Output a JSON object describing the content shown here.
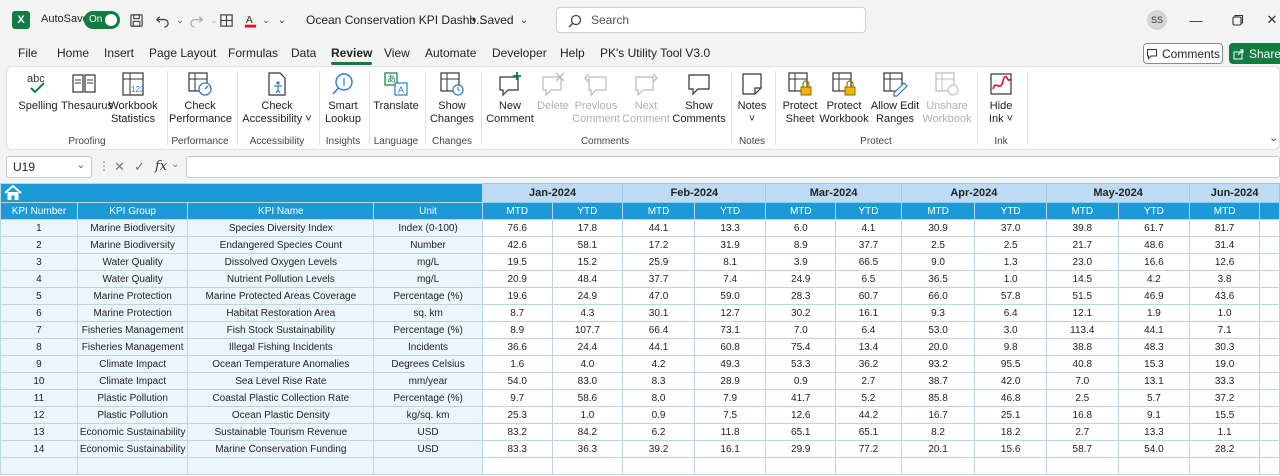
{
  "titlebar": {
    "logo": "X",
    "autosave_label": "AutoSave",
    "toggle_text": "On",
    "doc_title": "Ocean Conservation KPI Dashb...",
    "saved": "• Saved",
    "search_placeholder": "Search",
    "avatar": "SS"
  },
  "menu": [
    "File",
    "Home",
    "Insert",
    "Page Layout",
    "Formulas",
    "Data",
    "Review",
    "View",
    "Automate",
    "Developer",
    "Help",
    "PK's Utility Tool V3.0"
  ],
  "menu_active": "Review",
  "comments_label": "Comments",
  "share_label": "Share",
  "ribbon": {
    "spelling": "Spelling",
    "thesaurus": "Thesaurus",
    "workbook_statistics_1": "Workbook",
    "workbook_statistics_2": "Statistics",
    "check_performance_1": "Check",
    "check_performance_2": "Performance",
    "check_accessibility_1": "Check",
    "check_accessibility_2": "Accessibility ˅",
    "smart_lookup_1": "Smart",
    "smart_lookup_2": "Lookup",
    "translate": "Translate",
    "show_changes_1": "Show",
    "show_changes_2": "Changes",
    "new_comment_1": "New",
    "new_comment_2": "Comment",
    "delete": "Delete",
    "previous_comment_1": "Previous",
    "previous_comment_2": "Comment",
    "next_comment_1": "Next",
    "next_comment_2": "Comment",
    "show_comments_1": "Show",
    "show_comments_2": "Comments",
    "notes_1": "Notes",
    "notes_2": "˅",
    "protect_sheet_1": "Protect",
    "protect_sheet_2": "Sheet",
    "protect_workbook_1": "Protect",
    "protect_workbook_2": "Workbook",
    "allow_edit_ranges_1": "Allow Edit",
    "allow_edit_ranges_2": "Ranges",
    "unshare_workbook_1": "Unshare",
    "unshare_workbook_2": "Workbook",
    "hide_ink_1": "Hide",
    "hide_ink_2": "Ink ˅",
    "groups": {
      "proofing": "Proofing",
      "performance": "Performance",
      "accessibility": "Accessibility",
      "insights": "Insights",
      "language": "Language",
      "changes": "Changes",
      "comments": "Comments",
      "notes": "Notes",
      "protect": "Protect",
      "ink": "Ink"
    }
  },
  "formula_bar": {
    "name_box": "U19",
    "fx": "fx"
  },
  "grid": {
    "months": [
      "Jan-2024",
      "Feb-2024",
      "Mar-2024",
      "Apr-2024",
      "May-2024",
      "Jun-2024"
    ],
    "headers": [
      "KPI Number",
      "KPI Group",
      "KPI Name",
      "Unit"
    ],
    "mtd": "MTD",
    "ytd": "YTD",
    "rows": [
      {
        "n": "1",
        "group": "Marine Biodiversity",
        "name": "Species Diversity Index",
        "unit": "Index (0-100)",
        "vals": [
          "76.6",
          "17.8",
          "44.1",
          "13.3",
          "6.0",
          "4.1",
          "30.9",
          "37.0",
          "39.8",
          "61.7",
          "81.7"
        ]
      },
      {
        "n": "2",
        "group": "Marine Biodiversity",
        "name": "Endangered Species Count",
        "unit": "Number",
        "vals": [
          "42.6",
          "58.1",
          "17.2",
          "31.9",
          "8.9",
          "37.7",
          "2.5",
          "2.5",
          "21.7",
          "48.6",
          "31.4"
        ]
      },
      {
        "n": "3",
        "group": "Water Quality",
        "name": "Dissolved Oxygen Levels",
        "unit": "mg/L",
        "vals": [
          "19.5",
          "15.2",
          "25.9",
          "8.1",
          "3.9",
          "66.5",
          "9.0",
          "1.3",
          "23.0",
          "16.6",
          "12.6"
        ]
      },
      {
        "n": "4",
        "group": "Water Quality",
        "name": "Nutrient Pollution Levels",
        "unit": "mg/L",
        "vals": [
          "20.9",
          "48.4",
          "37.7",
          "7.4",
          "24.9",
          "6.5",
          "36.5",
          "1.0",
          "14.5",
          "4.2",
          "3.8"
        ]
      },
      {
        "n": "5",
        "group": "Marine Protection",
        "name": "Marine Protected Areas Coverage",
        "unit": "Percentage (%)",
        "vals": [
          "19.6",
          "24.9",
          "47.0",
          "59.0",
          "28.3",
          "60.7",
          "66.0",
          "57.8",
          "51.5",
          "46.9",
          "43.6"
        ]
      },
      {
        "n": "6",
        "group": "Marine Protection",
        "name": "Habitat Restoration Area",
        "unit": "sq. km",
        "vals": [
          "8.7",
          "4.3",
          "30.1",
          "12.7",
          "30.2",
          "16.1",
          "9.3",
          "6.4",
          "12.1",
          "1.9",
          "1.0"
        ]
      },
      {
        "n": "7",
        "group": "Fisheries Management",
        "name": "Fish Stock Sustainability",
        "unit": "Percentage (%)",
        "vals": [
          "8.9",
          "107.7",
          "66.4",
          "73.1",
          "7.0",
          "6.4",
          "53.0",
          "3.0",
          "113.4",
          "44.1",
          "7.1"
        ]
      },
      {
        "n": "8",
        "group": "Fisheries Management",
        "name": "Illegal Fishing Incidents",
        "unit": "Incidents",
        "vals": [
          "36.6",
          "24.4",
          "44.1",
          "60.8",
          "75.4",
          "13.4",
          "20.0",
          "9.8",
          "38.8",
          "48.3",
          "30.3"
        ]
      },
      {
        "n": "9",
        "group": "Climate Impact",
        "name": "Ocean Temperature Anomalies",
        "unit": "Degrees Celsius",
        "vals": [
          "1.6",
          "4.0",
          "4.2",
          "49.3",
          "53.3",
          "36.2",
          "93.2",
          "95.5",
          "40.8",
          "15.3",
          "19.0"
        ]
      },
      {
        "n": "10",
        "group": "Climate Impact",
        "name": "Sea Level Rise Rate",
        "unit": "mm/year",
        "vals": [
          "54.0",
          "83.0",
          "8.3",
          "28.9",
          "0.9",
          "2.7",
          "38.7",
          "42.0",
          "7.0",
          "13.1",
          "33.3"
        ]
      },
      {
        "n": "11",
        "group": "Plastic Pollution",
        "name": "Coastal Plastic Collection Rate",
        "unit": "Percentage (%)",
        "vals": [
          "9.7",
          "58.6",
          "8.0",
          "7.9",
          "41.7",
          "5.2",
          "85.8",
          "46.8",
          "2.5",
          "5.7",
          "37.2"
        ]
      },
      {
        "n": "12",
        "group": "Plastic Pollution",
        "name": "Ocean Plastic Density",
        "unit": "kg/sq. km",
        "vals": [
          "25.3",
          "1.0",
          "0.9",
          "7.5",
          "12.6",
          "44.2",
          "16.7",
          "25.1",
          "16.8",
          "9.1",
          "15.5"
        ]
      },
      {
        "n": "13",
        "group": "Economic Sustainability",
        "name": "Sustainable Tourism Revenue",
        "unit": "USD",
        "vals": [
          "83.2",
          "84.2",
          "6.2",
          "11.8",
          "65.1",
          "65.1",
          "8.2",
          "18.2",
          "2.7",
          "13.3",
          "1.1"
        ]
      },
      {
        "n": "14",
        "group": "Economic Sustainability",
        "name": "Marine Conservation Funding",
        "unit": "USD",
        "vals": [
          "83.3",
          "36.3",
          "39.2",
          "16.1",
          "29.9",
          "77.2",
          "20.1",
          "15.6",
          "58.7",
          "54.0",
          "28.2"
        ]
      }
    ]
  },
  "colors": {
    "excel_green": "#107c41",
    "header_blue": "#1a9bd7",
    "month_blue": "#bddcf4",
    "row_tint": "#eaf6fc"
  }
}
